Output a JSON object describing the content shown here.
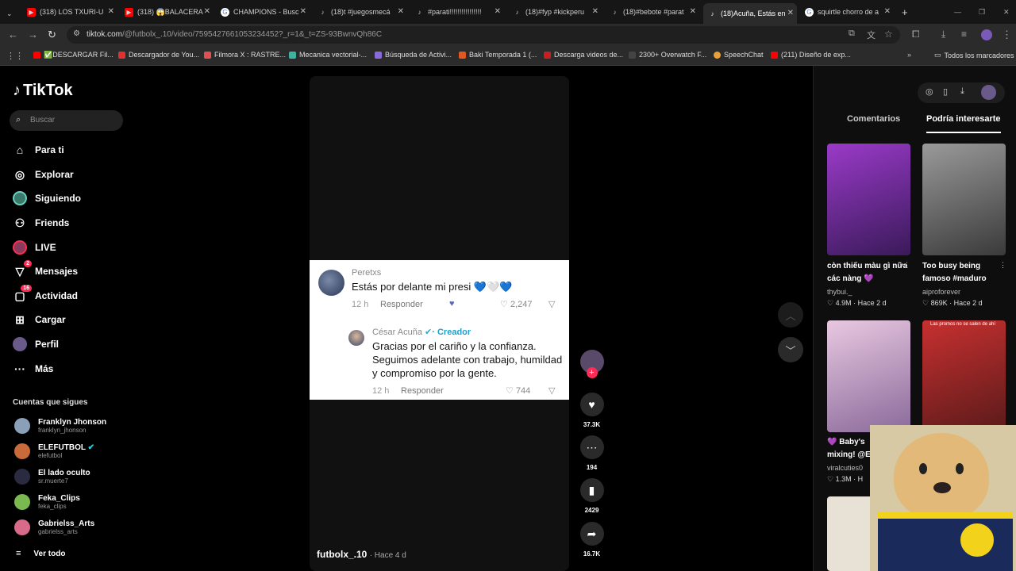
{
  "browser": {
    "tabs": [
      {
        "label": "(318) LOS TXURI-U",
        "icon": "youtube-icon",
        "color": "#ff0000"
      },
      {
        "label": "(318) 😱BALACERA",
        "icon": "youtube-icon",
        "color": "#ff0000"
      },
      {
        "label": "CHAMPIONS - Busc",
        "icon": "google-icon",
        "color": "#4285f4"
      },
      {
        "label": "(18)t #juegosmecá",
        "icon": "tiktok-icon",
        "color": "#000000"
      },
      {
        "label": "#parati!!!!!!!!!!!!!!!!",
        "icon": "tiktok-icon",
        "color": "#000000"
      },
      {
        "label": "(18)#fyp #kickperu",
        "icon": "tiktok-icon",
        "color": "#000000"
      },
      {
        "label": "(18)#bebote #parat",
        "icon": "tiktok-icon",
        "color": "#000000"
      },
      {
        "label": "(18)Acuña, Estás en",
        "icon": "tiktok-icon",
        "color": "#000000",
        "active": true
      },
      {
        "label": "squirtle chorro de a",
        "icon": "google-icon",
        "color": "#4285f4"
      }
    ],
    "url_host": "tiktok.com",
    "url_path": "/@futbolx_.10/video/7595427661053234452?_r=1&_t=ZS-93BwnvQh86C",
    "bookmarks": [
      {
        "label": "✅DESCARGAR Fil...",
        "color": "#ff0000"
      },
      {
        "label": "Descargador de You...",
        "color": "#e03030"
      },
      {
        "label": "Filmora X : RASTRE...",
        "color": "#e05050"
      },
      {
        "label": "Mecanica vectorial-...",
        "color": "#3fb3a0"
      },
      {
        "label": "Búsqueda de Activi...",
        "color": "#8a6ad8"
      },
      {
        "label": "Baki Temporada 1 (...",
        "color": "#e25822"
      },
      {
        "label": "Descarga videos de...",
        "color": "#c81e1e"
      },
      {
        "label": "2300+ Overwatch F...",
        "color": "#444444"
      },
      {
        "label": "SpeechChat",
        "color": "#e8a13a"
      },
      {
        "label": "(211) Diseño de exp...",
        "color": "#ff0000"
      }
    ],
    "all_bookmarks": "Todos los marcadores"
  },
  "sidebar": {
    "logo": "TikTok",
    "search_placeholder": "Buscar",
    "items": [
      {
        "label": "Para ti",
        "icon": "home-icon"
      },
      {
        "label": "Explorar",
        "icon": "compass-icon"
      },
      {
        "label": "Siguiendo",
        "icon": "following-icon"
      },
      {
        "label": "Friends",
        "icon": "friends-icon"
      },
      {
        "label": "LIVE",
        "icon": "live-icon"
      },
      {
        "label": "Mensajes",
        "icon": "message-icon",
        "badge": "2"
      },
      {
        "label": "Actividad",
        "icon": "activity-icon",
        "badge": "16"
      },
      {
        "label": "Cargar",
        "icon": "upload-icon"
      },
      {
        "label": "Perfil",
        "icon": "profile-icon"
      },
      {
        "label": "Más",
        "icon": "more-icon"
      }
    ],
    "following_title": "Cuentas que sigues",
    "following": [
      {
        "name": "Franklyn Jhonson",
        "handle": "franklyn_jhonson",
        "color": "#8aa0b8"
      },
      {
        "name": "ELEFUTBOL",
        "handle": "elefutbol",
        "color": "#c86a3a",
        "verified": true
      },
      {
        "name": "El lado oculto",
        "handle": "sr.muerte7",
        "color": "#2a2a40"
      },
      {
        "name": "Feka_Clips",
        "handle": "feka_clips",
        "color": "#7ab850"
      },
      {
        "name": "Gabrielss_Arts",
        "handle": "gabrielss_arts",
        "color": "#d86a8a"
      }
    ],
    "see_all": "Ver todo"
  },
  "comment": {
    "user": "Peretxs",
    "text": "Estás por delante mi presi 💙🤍💙",
    "time": "12 h",
    "reply_label": "Responder",
    "likes": "2,247",
    "reply": {
      "user": "César Acuña",
      "creator_label": "· Creador",
      "text": "Gracias por el cariño y la confianza. Seguimos adelante con trabajo, humildad y compromiso por la gente.",
      "time": "12 h",
      "reply_label": "Responder",
      "likes": "744"
    }
  },
  "video": {
    "author": "futbolx_.10",
    "age": "· Hace 4 d"
  },
  "actions": {
    "likes": "37.3K",
    "comments": "194",
    "saves": "2429",
    "shares": "16.7K"
  },
  "right_panel": {
    "tab_comments": "Comentarios",
    "tab_interesting": "Podría interesarte",
    "cards": [
      {
        "title": "còn thiếu màu gì nữa các nàng 💜",
        "author": "thybui._",
        "stats": "♡ 4.9M · Hace 2 d",
        "color": "#7a2aa8"
      },
      {
        "title": "Too busy being famoso #maduro",
        "author": "aiproforever",
        "stats": "♡ 869K · Hace 2 d",
        "color": "#6a6a6a"
      },
      {
        "title": "💜 Baby's mixing! @E",
        "author": "viralcuties0",
        "stats": "♡ 1.3M · H",
        "color": "#c8a0c8"
      },
      {
        "title": "Las promos no se salen de ahí",
        "author": "",
        "stats": "",
        "color": "#b02020"
      }
    ]
  }
}
